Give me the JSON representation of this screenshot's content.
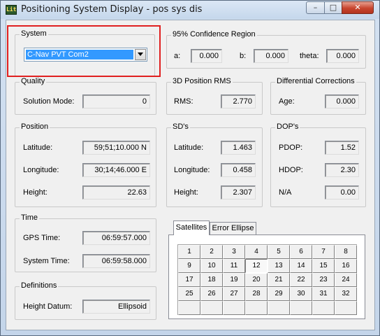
{
  "window": {
    "title": "Positioning System Display - pos sys dis",
    "icon_text": "Lit"
  },
  "system": {
    "label": "System",
    "selected": "C-Nav PVT Com2"
  },
  "confidence": {
    "label": "95% Confidence Region",
    "a_label": "a:",
    "a_value": "0.000",
    "b_label": "b:",
    "b_value": "0.000",
    "theta_label": "theta:",
    "theta_value": "0.000"
  },
  "quality": {
    "label": "Quality",
    "solution_mode_label": "Solution Mode:",
    "solution_mode_value": "0"
  },
  "rms": {
    "label": "3D Position RMS",
    "rms_label": "RMS:",
    "rms_value": "2.770"
  },
  "diff": {
    "label": "Differential Corrections",
    "age_label": "Age:",
    "age_value": "0.000"
  },
  "position": {
    "label": "Position",
    "lat_label": "Latitude:",
    "lat_value": "59;51;10.000 N",
    "lon_label": "Longitude:",
    "lon_value": "30;14;46.000 E",
    "height_label": "Height:",
    "height_value": "22.63"
  },
  "sds": {
    "label": "SD's",
    "lat_label": "Latitude:",
    "lat_value": "1.463",
    "lon_label": "Longitude:",
    "lon_value": "0.458",
    "height_label": "Height:",
    "height_value": "2.307"
  },
  "dops": {
    "label": "DOP's",
    "pdop_label": "PDOP:",
    "pdop_value": "1.52",
    "hdop_label": "HDOP:",
    "hdop_value": "2.30",
    "na_label": "N/A",
    "na_value": "0.00"
  },
  "time": {
    "label": "Time",
    "gps_label": "GPS Time:",
    "gps_value": "06:59:57.000",
    "sys_label": "System Time:",
    "sys_value": "06:59:58.000"
  },
  "definitions": {
    "label": "Definitions",
    "datum_label": "Height Datum:",
    "datum_value": "Ellipsoid"
  },
  "tabs": {
    "satellites": "Satellites",
    "error_ellipse": "Error Ellipse"
  },
  "satellites": {
    "cells": [
      "1",
      "2",
      "3",
      "4",
      "5",
      "6",
      "7",
      "8",
      "9",
      "10",
      "11",
      "12",
      "13",
      "14",
      "15",
      "16",
      "17",
      "18",
      "19",
      "20",
      "21",
      "22",
      "23",
      "24",
      "25",
      "26",
      "27",
      "28",
      "29",
      "30",
      "31",
      "32",
      "",
      "",
      "",
      "",
      "",
      "",
      "",
      ""
    ],
    "selected": "12"
  },
  "colors": {
    "highlight": "#e02020",
    "selection": "#3399ff"
  }
}
